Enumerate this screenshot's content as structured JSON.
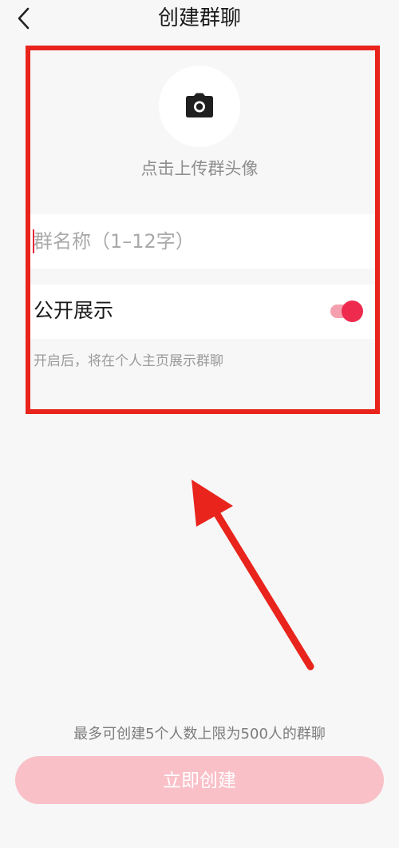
{
  "header": {
    "title": "创建群聊",
    "back_icon": "chevron-left-icon"
  },
  "avatar": {
    "icon": "camera-icon",
    "label": "点击上传群头像"
  },
  "group_name": {
    "value": "",
    "placeholder": "群名称（1–12字）"
  },
  "public_display": {
    "label": "公开展示",
    "enabled": true,
    "hint": "开启后，将在个人主页展示群聊"
  },
  "footer": {
    "limit_note": "最多可创建5个人数上限为500人的群聊",
    "create_label": "立即创建"
  },
  "colors": {
    "accent": "#ee2a4f",
    "button_disabled": "#f9c0c8",
    "annotation": "#e8241c"
  }
}
